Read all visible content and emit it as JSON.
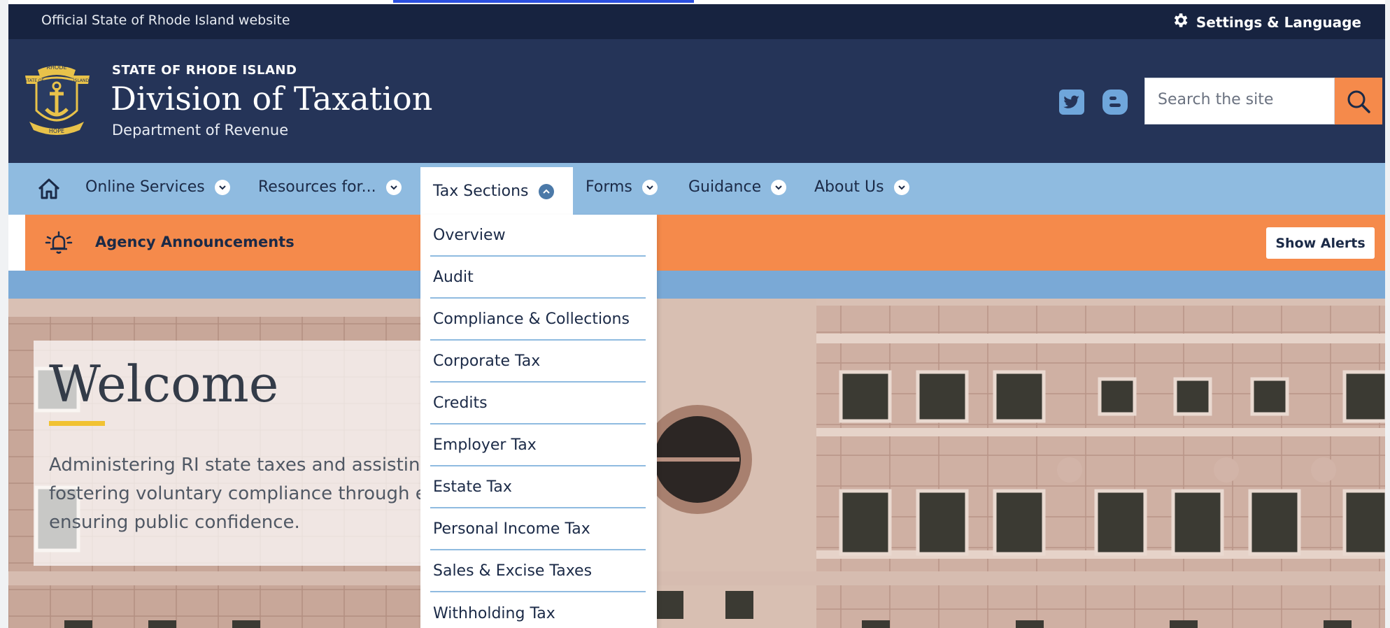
{
  "utility": {
    "official_text": "Official State of Rhode Island website",
    "settings_label": "Settings & Language"
  },
  "header": {
    "kicker": "STATE OF RHODE ISLAND",
    "title": "Division of Taxation",
    "subtitle": "Department of Revenue",
    "seal_text_top": "RHODE",
    "seal_text_left": "STATE OF",
    "seal_text_right": "ISLAND",
    "seal_motto": "HOPE",
    "social": [
      "twitter-icon",
      "blogger-icon"
    ],
    "search_placeholder": "Search the site"
  },
  "nav": {
    "items": [
      {
        "label": "Online Services"
      },
      {
        "label": "Resources for..."
      },
      {
        "label": "Tax Sections",
        "active": true
      },
      {
        "label": "Forms"
      },
      {
        "label": "Guidance"
      },
      {
        "label": "About Us"
      }
    ]
  },
  "alerts": {
    "label": "Agency Announcements",
    "button": "Show Alerts"
  },
  "hero": {
    "title": "Welcome",
    "description": "Administering RI state taxes and assisting taxpayers, fostering voluntary compliance through education, and ensuring public confidence."
  },
  "dropdown": {
    "items": [
      "Overview",
      "Audit",
      "Compliance & Collections",
      "Corporate Tax",
      "Credits",
      "Employer Tax",
      "Estate Tax",
      "Personal Income Tax",
      "Sales & Excise Taxes",
      "Withholding Tax"
    ]
  },
  "colors": {
    "utility_bg": "#172340",
    "header_bg": "#253458",
    "nav_bg": "#8fbbe0",
    "accent_orange": "#f58a4b",
    "rule_yellow": "#f1c232"
  }
}
